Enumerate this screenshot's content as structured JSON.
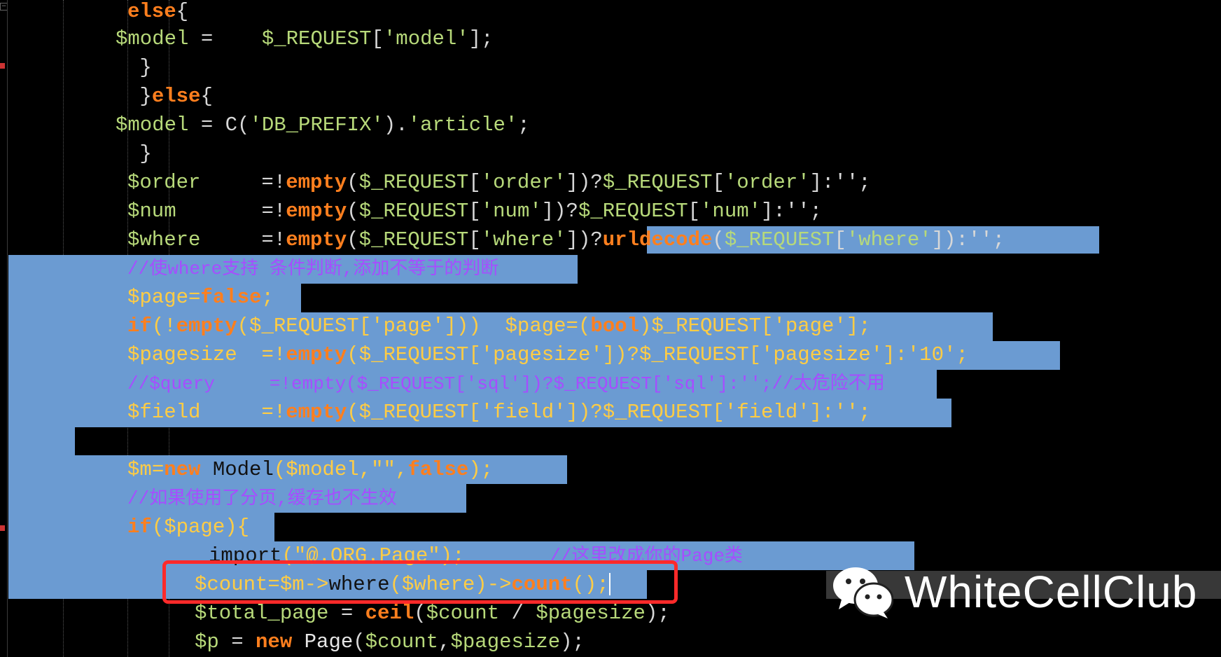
{
  "editor": {
    "lines": [
      {
        "selected": false,
        "tokens": [
          {
            "c": "kw",
            "t": "else"
          },
          {
            "c": "op",
            "t": "{"
          }
        ]
      },
      {
        "selected": false,
        "tokens": [
          {
            "c": "var",
            "t": "$model"
          },
          {
            "c": "op",
            "t": " =    "
          },
          {
            "c": "var",
            "t": "$_REQUEST"
          },
          {
            "c": "op",
            "t": "["
          },
          {
            "c": "str",
            "t": "'model'"
          },
          {
            "c": "op",
            "t": "];"
          }
        ]
      },
      {
        "selected": false,
        "tokens": [
          {
            "c": "op",
            "t": " }"
          }
        ]
      },
      {
        "selected": false,
        "tokens": [
          {
            "c": "op",
            "t": " }"
          },
          {
            "c": "kw",
            "t": "else"
          },
          {
            "c": "op",
            "t": "{"
          }
        ]
      },
      {
        "selected": false,
        "tokens": [
          {
            "c": "var",
            "t": "$model"
          },
          {
            "c": "op",
            "t": " = C("
          },
          {
            "c": "str",
            "t": "'DB_PREFIX'"
          },
          {
            "c": "op",
            "t": ")."
          },
          {
            "c": "str",
            "t": "'article'"
          },
          {
            "c": "op",
            "t": ";"
          }
        ]
      },
      {
        "selected": false,
        "tokens": [
          {
            "c": "op",
            "t": " }"
          }
        ]
      },
      {
        "selected": false,
        "tokens": [
          {
            "c": "var",
            "t": "$order"
          },
          {
            "c": "op",
            "t": "     =!"
          },
          {
            "c": "kw",
            "t": "empty"
          },
          {
            "c": "op",
            "t": "("
          },
          {
            "c": "var",
            "t": "$_REQUEST"
          },
          {
            "c": "op",
            "t": "["
          },
          {
            "c": "str",
            "t": "'order'"
          },
          {
            "c": "op",
            "t": "])?"
          },
          {
            "c": "var",
            "t": "$_REQUEST"
          },
          {
            "c": "op",
            "t": "["
          },
          {
            "c": "str",
            "t": "'order'"
          },
          {
            "c": "op",
            "t": "]:'';"
          }
        ]
      },
      {
        "selected": false,
        "tokens": [
          {
            "c": "var",
            "t": "$num"
          },
          {
            "c": "op",
            "t": "       =!"
          },
          {
            "c": "kw",
            "t": "empty"
          },
          {
            "c": "op",
            "t": "("
          },
          {
            "c": "var",
            "t": "$_REQUEST"
          },
          {
            "c": "op",
            "t": "["
          },
          {
            "c": "str",
            "t": "'num'"
          },
          {
            "c": "op",
            "t": "])?"
          },
          {
            "c": "var",
            "t": "$_REQUEST"
          },
          {
            "c": "op",
            "t": "["
          },
          {
            "c": "str",
            "t": "'num'"
          },
          {
            "c": "op",
            "t": "]:'';"
          }
        ]
      },
      {
        "selected": false,
        "tokens": [
          {
            "c": "var",
            "t": "$where"
          },
          {
            "c": "op",
            "t": "     =!"
          },
          {
            "c": "kw",
            "t": "empty"
          },
          {
            "c": "op",
            "t": "("
          },
          {
            "c": "var",
            "t": "$_REQUEST"
          },
          {
            "c": "op",
            "t": "["
          },
          {
            "c": "str",
            "t": "'where'"
          },
          {
            "c": "op",
            "t": "])?"
          },
          {
            "c": "kw",
            "t": "urldecode"
          },
          {
            "c": "op",
            "t": "("
          },
          {
            "c": "var",
            "t": "$_REQUEST"
          },
          {
            "c": "op",
            "t": "["
          },
          {
            "c": "str",
            "t": "'where'"
          },
          {
            "c": "op",
            "t": "]):'';"
          }
        ]
      },
      {
        "selected": true,
        "tokens": [
          {
            "c": "cm",
            "t": "//使where支持 条件判断,添加不等于的判断"
          }
        ]
      },
      {
        "selected": true,
        "tokens": [
          {
            "c": "var",
            "t": "$page"
          },
          {
            "c": "op",
            "t": "="
          },
          {
            "c": "kw",
            "t": "false"
          },
          {
            "c": "op",
            "t": ";"
          }
        ]
      },
      {
        "selected": true,
        "tokens": [
          {
            "c": "kw",
            "t": "if"
          },
          {
            "c": "op",
            "t": "(!"
          },
          {
            "c": "kw",
            "t": "empty"
          },
          {
            "c": "op",
            "t": "("
          },
          {
            "c": "var",
            "t": "$_REQUEST"
          },
          {
            "c": "op",
            "t": "["
          },
          {
            "c": "str",
            "t": "'page'"
          },
          {
            "c": "op",
            "t": "]))  "
          },
          {
            "c": "var",
            "t": "$page"
          },
          {
            "c": "op",
            "t": "=("
          },
          {
            "c": "kw",
            "t": "bool"
          },
          {
            "c": "op",
            "t": ")"
          },
          {
            "c": "var",
            "t": "$_REQUEST"
          },
          {
            "c": "op",
            "t": "["
          },
          {
            "c": "str",
            "t": "'page'"
          },
          {
            "c": "op",
            "t": "];"
          }
        ]
      },
      {
        "selected": true,
        "tokens": [
          {
            "c": "var",
            "t": "$pagesize"
          },
          {
            "c": "op",
            "t": "  =!"
          },
          {
            "c": "kw",
            "t": "empty"
          },
          {
            "c": "op",
            "t": "("
          },
          {
            "c": "var",
            "t": "$_REQUEST"
          },
          {
            "c": "op",
            "t": "["
          },
          {
            "c": "str",
            "t": "'pagesize'"
          },
          {
            "c": "op",
            "t": "])?"
          },
          {
            "c": "var",
            "t": "$_REQUEST"
          },
          {
            "c": "op",
            "t": "["
          },
          {
            "c": "str",
            "t": "'pagesize'"
          },
          {
            "c": "op",
            "t": "]:"
          },
          {
            "c": "str",
            "t": "'10'"
          },
          {
            "c": "op",
            "t": ";"
          }
        ]
      },
      {
        "selected": true,
        "tokens": [
          {
            "c": "cm",
            "t": "//$query     =!empty($_REQUEST['sql'])?$_REQUEST['sql']:'';//太危险不用"
          }
        ]
      },
      {
        "selected": true,
        "tokens": [
          {
            "c": "var",
            "t": "$field"
          },
          {
            "c": "op",
            "t": "     =!"
          },
          {
            "c": "kw",
            "t": "empty"
          },
          {
            "c": "op",
            "t": "("
          },
          {
            "c": "var",
            "t": "$_REQUEST"
          },
          {
            "c": "op",
            "t": "["
          },
          {
            "c": "str",
            "t": "'field'"
          },
          {
            "c": "op",
            "t": "])?"
          },
          {
            "c": "var",
            "t": "$_REQUEST"
          },
          {
            "c": "op",
            "t": "["
          },
          {
            "c": "str",
            "t": "'field'"
          },
          {
            "c": "op",
            "t": "]:'';"
          }
        ]
      },
      {
        "selected": true,
        "tokens": []
      },
      {
        "selected": true,
        "tokens": [
          {
            "c": "var",
            "t": "$m"
          },
          {
            "c": "op",
            "t": "="
          },
          {
            "c": "kw",
            "t": "new"
          },
          {
            "c": "plain",
            "t": " Model"
          },
          {
            "c": "op",
            "t": "("
          },
          {
            "c": "var",
            "t": "$model"
          },
          {
            "c": "op",
            "t": ","
          },
          {
            "c": "str",
            "t": "\"\""
          },
          {
            "c": "op",
            "t": ","
          },
          {
            "c": "kw",
            "t": "false"
          },
          {
            "c": "op",
            "t": ");"
          }
        ]
      },
      {
        "selected": true,
        "tokens": [
          {
            "c": "cm",
            "t": "//如果使用了分页,缓存也不生效"
          }
        ]
      },
      {
        "selected": true,
        "tokens": [
          {
            "c": "kw",
            "t": "if"
          },
          {
            "c": "op",
            "t": "("
          },
          {
            "c": "var",
            "t": "$page"
          },
          {
            "c": "op",
            "t": "){"
          }
        ]
      },
      {
        "selected": true,
        "tokens": [
          {
            "c": "plain",
            "t": "import"
          },
          {
            "c": "op",
            "t": "("
          },
          {
            "c": "str",
            "t": "\"@.ORG.Page\""
          },
          {
            "c": "op",
            "t": ");       "
          },
          {
            "c": "cm",
            "t": "//这里改成你的Page类"
          }
        ]
      },
      {
        "selected": true,
        "tokens": [
          {
            "c": "var",
            "t": "$count"
          },
          {
            "c": "op",
            "t": "="
          },
          {
            "c": "var",
            "t": "$m"
          },
          {
            "c": "op",
            "t": "->"
          },
          {
            "c": "plain",
            "t": "where"
          },
          {
            "c": "op",
            "t": "("
          },
          {
            "c": "var",
            "t": "$where"
          },
          {
            "c": "op",
            "t": ")->"
          },
          {
            "c": "kw",
            "t": "count"
          },
          {
            "c": "op",
            "t": "();"
          }
        ],
        "cursor": true
      },
      {
        "selected": false,
        "tokens": [
          {
            "c": "var",
            "t": "$total_page"
          },
          {
            "c": "op",
            "t": " = "
          },
          {
            "c": "kw",
            "t": "ceil"
          },
          {
            "c": "op",
            "t": "("
          },
          {
            "c": "var",
            "t": "$count"
          },
          {
            "c": "op",
            "t": " / "
          },
          {
            "c": "var",
            "t": "$pagesize"
          },
          {
            "c": "op",
            "t": ");"
          }
        ]
      },
      {
        "selected": false,
        "tokens": [
          {
            "c": "var",
            "t": "$p"
          },
          {
            "c": "op",
            "t": " = "
          },
          {
            "c": "kw",
            "t": "new"
          },
          {
            "c": "plain",
            "t": " Page"
          },
          {
            "c": "op",
            "t": "("
          },
          {
            "c": "var",
            "t": "$count"
          },
          {
            "c": "op",
            "t": ","
          },
          {
            "c": "var",
            "t": "$pagesize"
          },
          {
            "c": "op",
            "t": ");"
          }
        ]
      }
    ]
  },
  "watermark": {
    "text": "WhiteCellClub",
    "icon": "wechat-icon"
  },
  "colors": {
    "background": "#000000",
    "selection": "#6b9bd2",
    "keyword": "#ff7f1e",
    "variable": "#b7d97a",
    "comment": "#a64dff",
    "highlight_box": "#ff2a2a"
  }
}
